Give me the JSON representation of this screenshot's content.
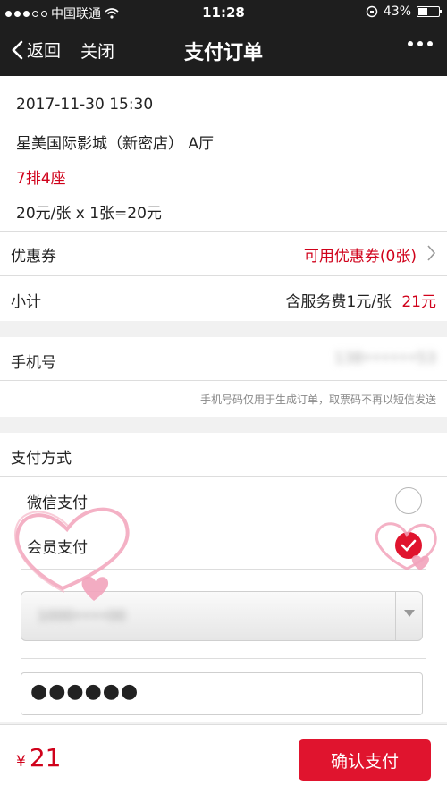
{
  "status_bar": {
    "carrier": "中国联通",
    "time": "11:28",
    "battery": "43%",
    "battery_level": 0.43
  },
  "nav": {
    "back_label": "返回",
    "close_label": "关闭",
    "title": "支付订单"
  },
  "order": {
    "datetime": "2017-11-30 15:30",
    "cinema": "星美国际影城（新密店） A厅",
    "seat": "7排4座",
    "price_calc": "20元/张 x 1张=20元"
  },
  "coupon": {
    "label": "优惠券",
    "value": "可用优惠券(0张)"
  },
  "subtotal": {
    "label": "小计",
    "service_fee": "含服务费1元/张",
    "amount": "21元"
  },
  "phone": {
    "label": "手机号",
    "value": "138••••••53",
    "note": "手机号码仅用于生成订单，取票码不再以短信发送"
  },
  "payment": {
    "section_label": "支付方式",
    "options": [
      {
        "label": "微信支付",
        "selected": false
      },
      {
        "label": "会员支付",
        "selected": true
      }
    ],
    "member_card_value": "1000••••00",
    "password_mask": "●●●●●●"
  },
  "footer": {
    "currency": "¥",
    "total": "21",
    "confirm_label": "确认支付"
  },
  "colors": {
    "accent": "#e0142e",
    "nav_bg": "#1e1e1e",
    "heart": "#f2a3bb"
  }
}
